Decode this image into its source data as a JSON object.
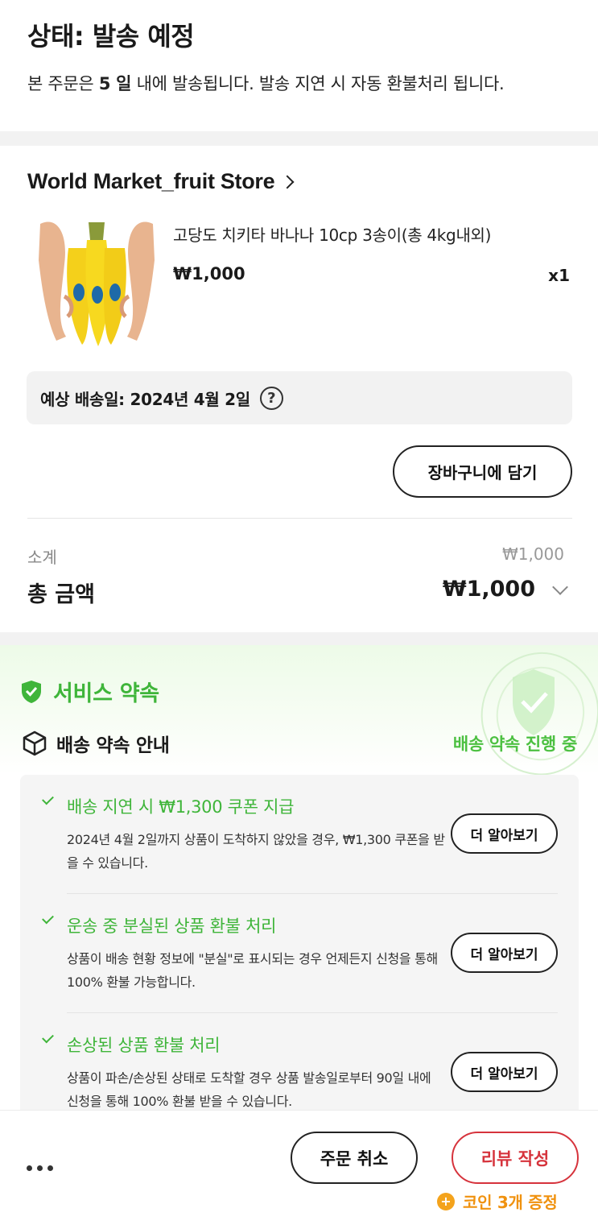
{
  "status": {
    "title": "상태: 발송 예정",
    "desc_prefix": "본 주문은 ",
    "desc_days": "5 일",
    "desc_suffix": " 내에 발송됩니다. 발송 지연 시 자동 환불처리 됩니다."
  },
  "store": {
    "name": "World Market_fruit Store"
  },
  "product": {
    "name": "고당도 치키타 바나나 10cp 3송이(총 4kg내외)",
    "price": "₩1,000",
    "quantity": "x1",
    "image_icon": "banana-product-image"
  },
  "delivery": {
    "expected": "예상 배송일: 2024년 4월 2일",
    "help_glyph": "?"
  },
  "cart_button": "장바구니에 담기",
  "summary": {
    "subtotal_label": "소계",
    "subtotal_value": "₩1,000",
    "total_label": "총 금액",
    "total_value": "₩1,000"
  },
  "service": {
    "title": "서비스 약속",
    "promise_label": "배송 약속 안내",
    "promise_status": "배송 약속 진행 중",
    "accent_color": "#3fb53a",
    "items": [
      {
        "title": "배송 지연 시 ₩1,300 쿠폰 지급",
        "desc": "2024년 4월 2일까지 상품이 도착하지 않았을 경우, ₩1,300 쿠폰을 받을 수 있습니다.",
        "button": "더 알아보기"
      },
      {
        "title": "운송 중 분실된 상품 환불 처리",
        "desc": "상품이 배송 현황 정보에 \"분실\"로 표시되는 경우 언제든지 신청을 통해 100% 환불 가능합니다.",
        "button": "더 알아보기"
      },
      {
        "title": "손상된 상품 환불 처리",
        "desc": "상품이 파손/손상된 상태로 도착할 경우 상품 발송일로부터 90일 내에 신청을 통해 100% 환불 받을 수 있습니다.",
        "button": "더 알아보기"
      }
    ]
  },
  "bottom": {
    "cancel": "주문 취소",
    "review": "리뷰 작성",
    "coin_reward": "코인 3개 증정",
    "coin_glyph": "+",
    "review_color": "#d6333c",
    "coin_color": "#f0920f"
  }
}
